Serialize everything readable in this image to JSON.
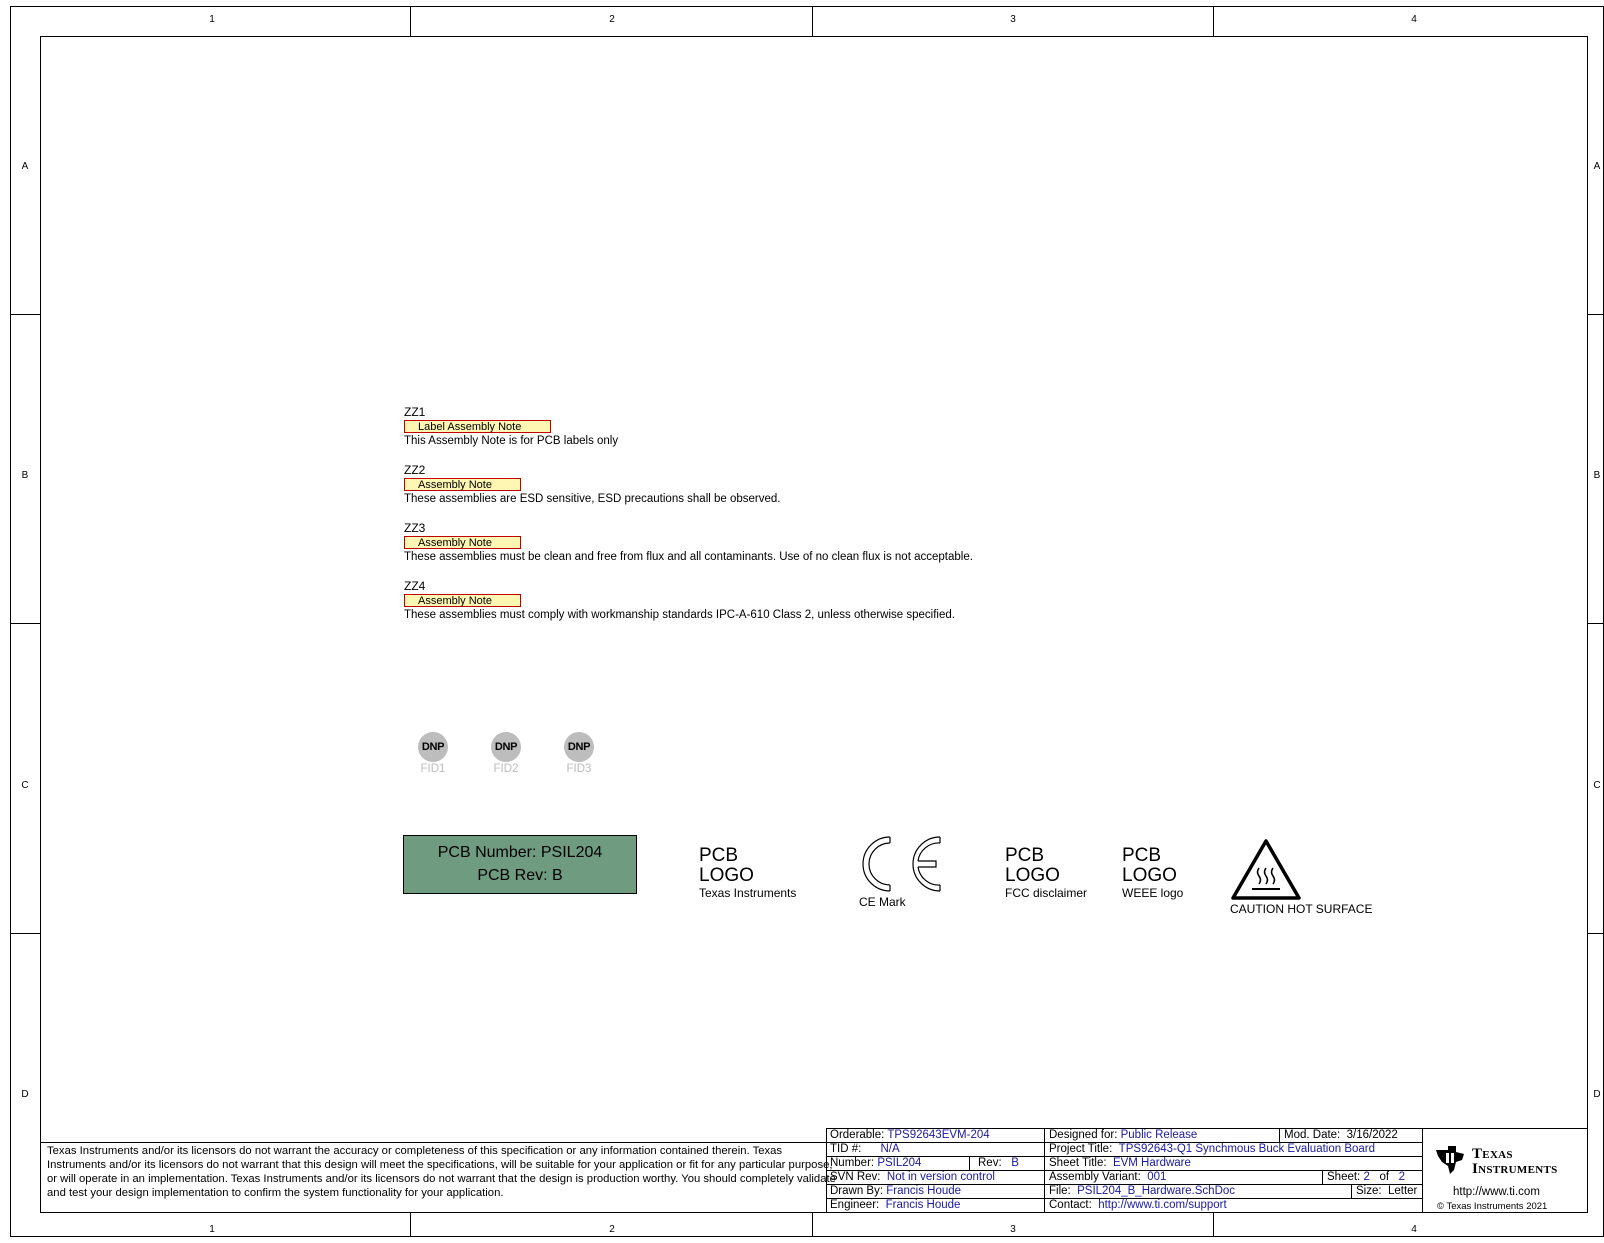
{
  "zones": {
    "columns": [
      "1",
      "2",
      "3",
      "4"
    ],
    "rows": [
      "A",
      "B",
      "C",
      "D"
    ]
  },
  "assembly_notes": [
    {
      "ref": "ZZ1",
      "tag": "Label Assembly Note",
      "text": "This Assembly Note is for PCB labels only"
    },
    {
      "ref": "ZZ2",
      "tag": "Assembly Note",
      "text": "These assemblies are ESD sensitive, ESD precautions shall be observed."
    },
    {
      "ref": "ZZ3",
      "tag": "Assembly Note",
      "text": "These assemblies must be clean and free from flux and all contaminants. Use of no clean flux is not acceptable."
    },
    {
      "ref": "ZZ4",
      "tag": "Assembly Note",
      "text": "These assemblies must comply with workmanship standards IPC-A-610 Class 2, unless otherwise specified."
    }
  ],
  "fiducials": [
    {
      "mark": "DNP",
      "ref": "FID1"
    },
    {
      "mark": "DNP",
      "ref": "FID2"
    },
    {
      "mark": "DNP",
      "ref": "FID3"
    }
  ],
  "pcb_label": {
    "number": "PCB Number: PSIL204",
    "rev": "PCB Rev: B"
  },
  "logos": {
    "ti": {
      "line1": "PCB",
      "line2": "LOGO",
      "caption": "Texas Instruments"
    },
    "ce": {
      "caption": "CE Mark"
    },
    "fcc": {
      "line1": "PCB",
      "line2": "LOGO",
      "caption": "FCC disclaimer"
    },
    "weee": {
      "line1": "PCB",
      "line2": "LOGO",
      "caption": "WEEE logo"
    },
    "hot": {
      "caption": "CAUTION HOT SURFACE"
    }
  },
  "disclaimer": "Texas Instruments and/or its licensors do not warrant the accuracy or completeness of this specification or any information contained therein. Texas Instruments and/or its licensors do not warrant that this design will meet the specifications, will be suitable for your application or fit for any particular purpose, or will operate in an implementation. Texas Instruments and/or its licensors do not warrant that the design is production worthy. You should completely validate and test your design implementation to confirm the system functionality for your application.",
  "title_block": {
    "orderable_k": "Orderable:",
    "orderable_v": "TPS92643EVM-204",
    "tid_k": "TID #:",
    "tid_v": "N/A",
    "number_k": "Number:",
    "number_v": "PSIL204",
    "rev_k": "Rev:",
    "rev_v": "B",
    "svn_k": "SVN Rev:",
    "svn_v": "Not in version control",
    "drawn_k": "Drawn By:",
    "drawn_v": "Francis Houde",
    "engineer_k": "Engineer:",
    "engineer_v": "Francis Houde",
    "designed_k": "Designed for:",
    "designed_v": "Public Release",
    "moddate_k": "Mod. Date:",
    "moddate_v": "3/16/2022",
    "project_k": "Project Title:",
    "project_v": "TPS92643-Q1 Synchmous Buck Evaluation Board",
    "sheet_title_k": "Sheet Title:",
    "sheet_title_v": "EVM Hardware",
    "sheet_k": "Sheet:",
    "sheet_v": "2",
    "sheet_of": "of",
    "sheet_total": "2",
    "variant_k": "Assembly Variant:",
    "variant_v": "001",
    "file_k": "File:",
    "file_v": "PSIL204_B_Hardware.SchDoc",
    "size_k": "Size:",
    "size_v": "Letter",
    "contact_k": "Contact:",
    "contact_v": "http://www.ti.com/support",
    "brand_line1": "Texas",
    "brand_line2": "Instruments",
    "url": "http://www.ti.com",
    "copyright": "© Texas Instruments  2021"
  },
  "colors": {
    "note_fill": "#fef7b4",
    "note_border": "#c00000",
    "pcb_label_fill": "#6f9c80",
    "fiducial_fill": "#bdbdbd",
    "title_value_text": "#1a1a9e"
  },
  "icons": [
    "ce-mark-icon",
    "hot-surface-warning-icon",
    "ti-logo-icon"
  ]
}
